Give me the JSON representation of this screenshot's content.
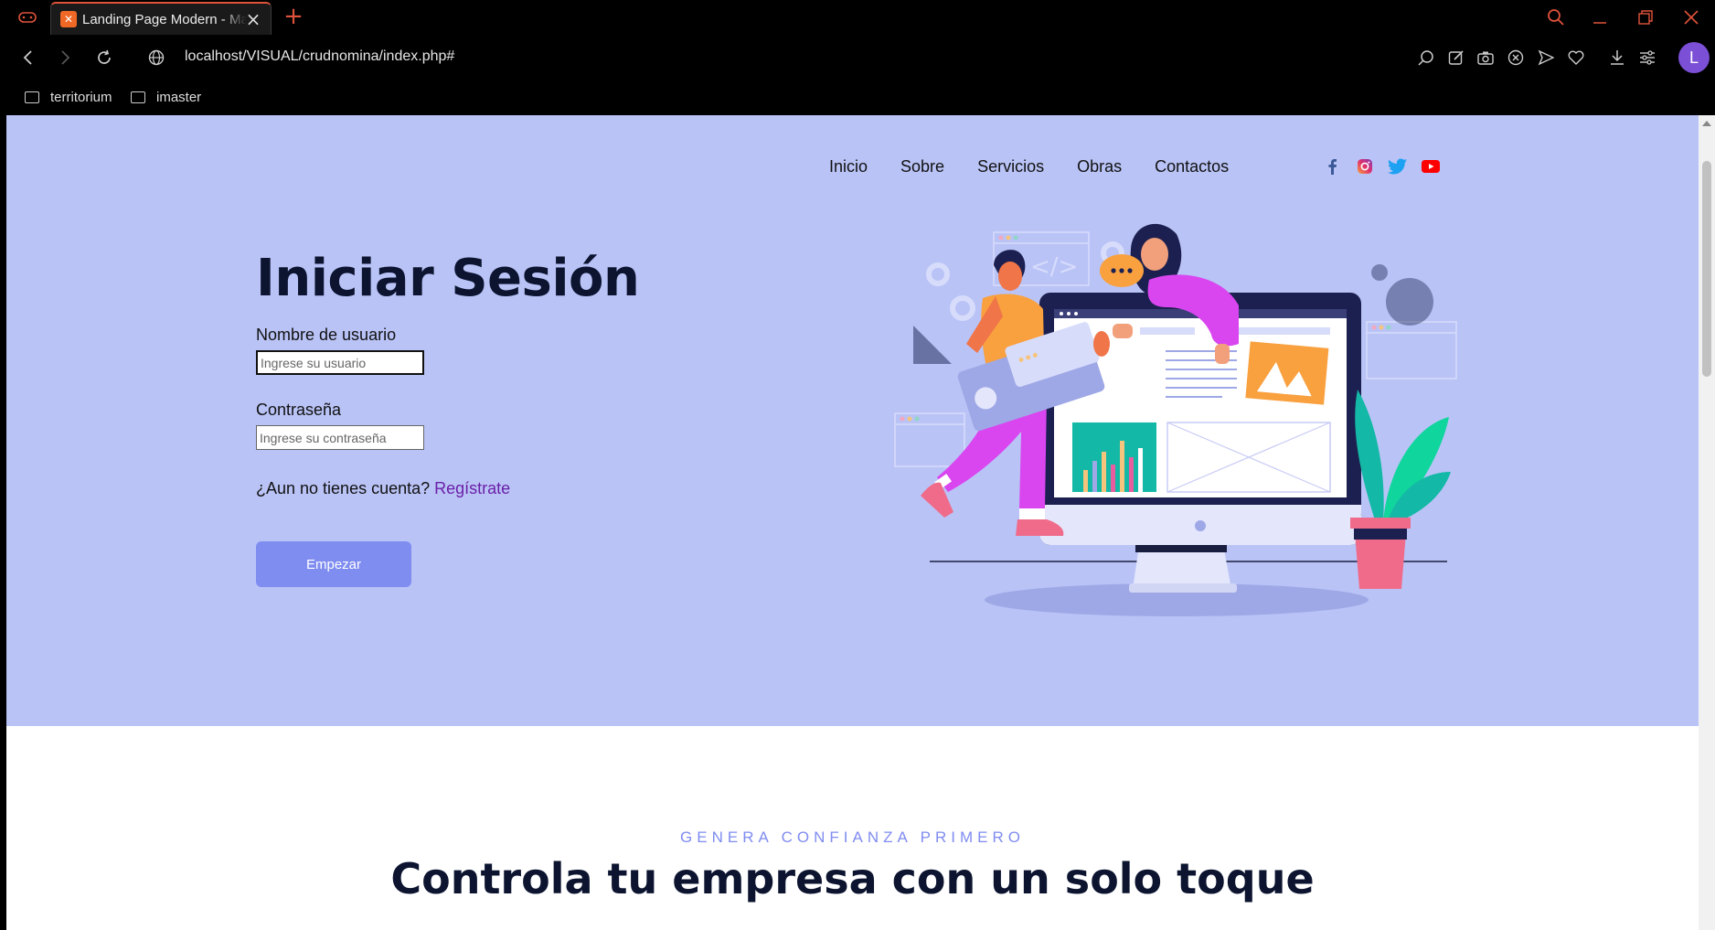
{
  "browser": {
    "tab_title": "Landing Page Modern - Ma",
    "url": "localhost/VISUAL/crudnomina/index.php#",
    "profile_initial": "L",
    "accent_color": "#e0533b",
    "bookmarks": [
      {
        "label": "territorium",
        "icon": "folder-icon"
      },
      {
        "label": "imaster",
        "icon": "folder-icon"
      }
    ],
    "toolbar_icons": [
      "search-page-icon",
      "edit-icon",
      "camera-icon",
      "extensions-icon",
      "send-icon",
      "heart-icon",
      "download-icon",
      "settings-icon"
    ]
  },
  "nav": {
    "links": [
      "Inicio",
      "Sobre",
      "Servicios",
      "Obras",
      "Contactos"
    ],
    "socials": [
      "facebook-icon",
      "instagram-icon",
      "twitter-icon",
      "youtube-icon"
    ]
  },
  "login": {
    "title": "Iniciar Sesión",
    "username_label": "Nombre de usuario",
    "username_placeholder": "Ingrese su usuario",
    "password_label": "Contraseña",
    "password_placeholder": "Ingrese su contraseña",
    "signup_prompt": "¿Aun no tienes cuenta?",
    "signup_link": "Regístrate",
    "start_button": "Empezar"
  },
  "section2": {
    "eyebrow": "GENERA CONFIANZA PRIMERO",
    "title": "Controla tu empresa con un solo toque"
  },
  "colors": {
    "hero_bg": "#b9c3f6",
    "button_bg": "#7f8cf0",
    "title_color": "#0c1430",
    "link_color": "#6a1fa8"
  }
}
